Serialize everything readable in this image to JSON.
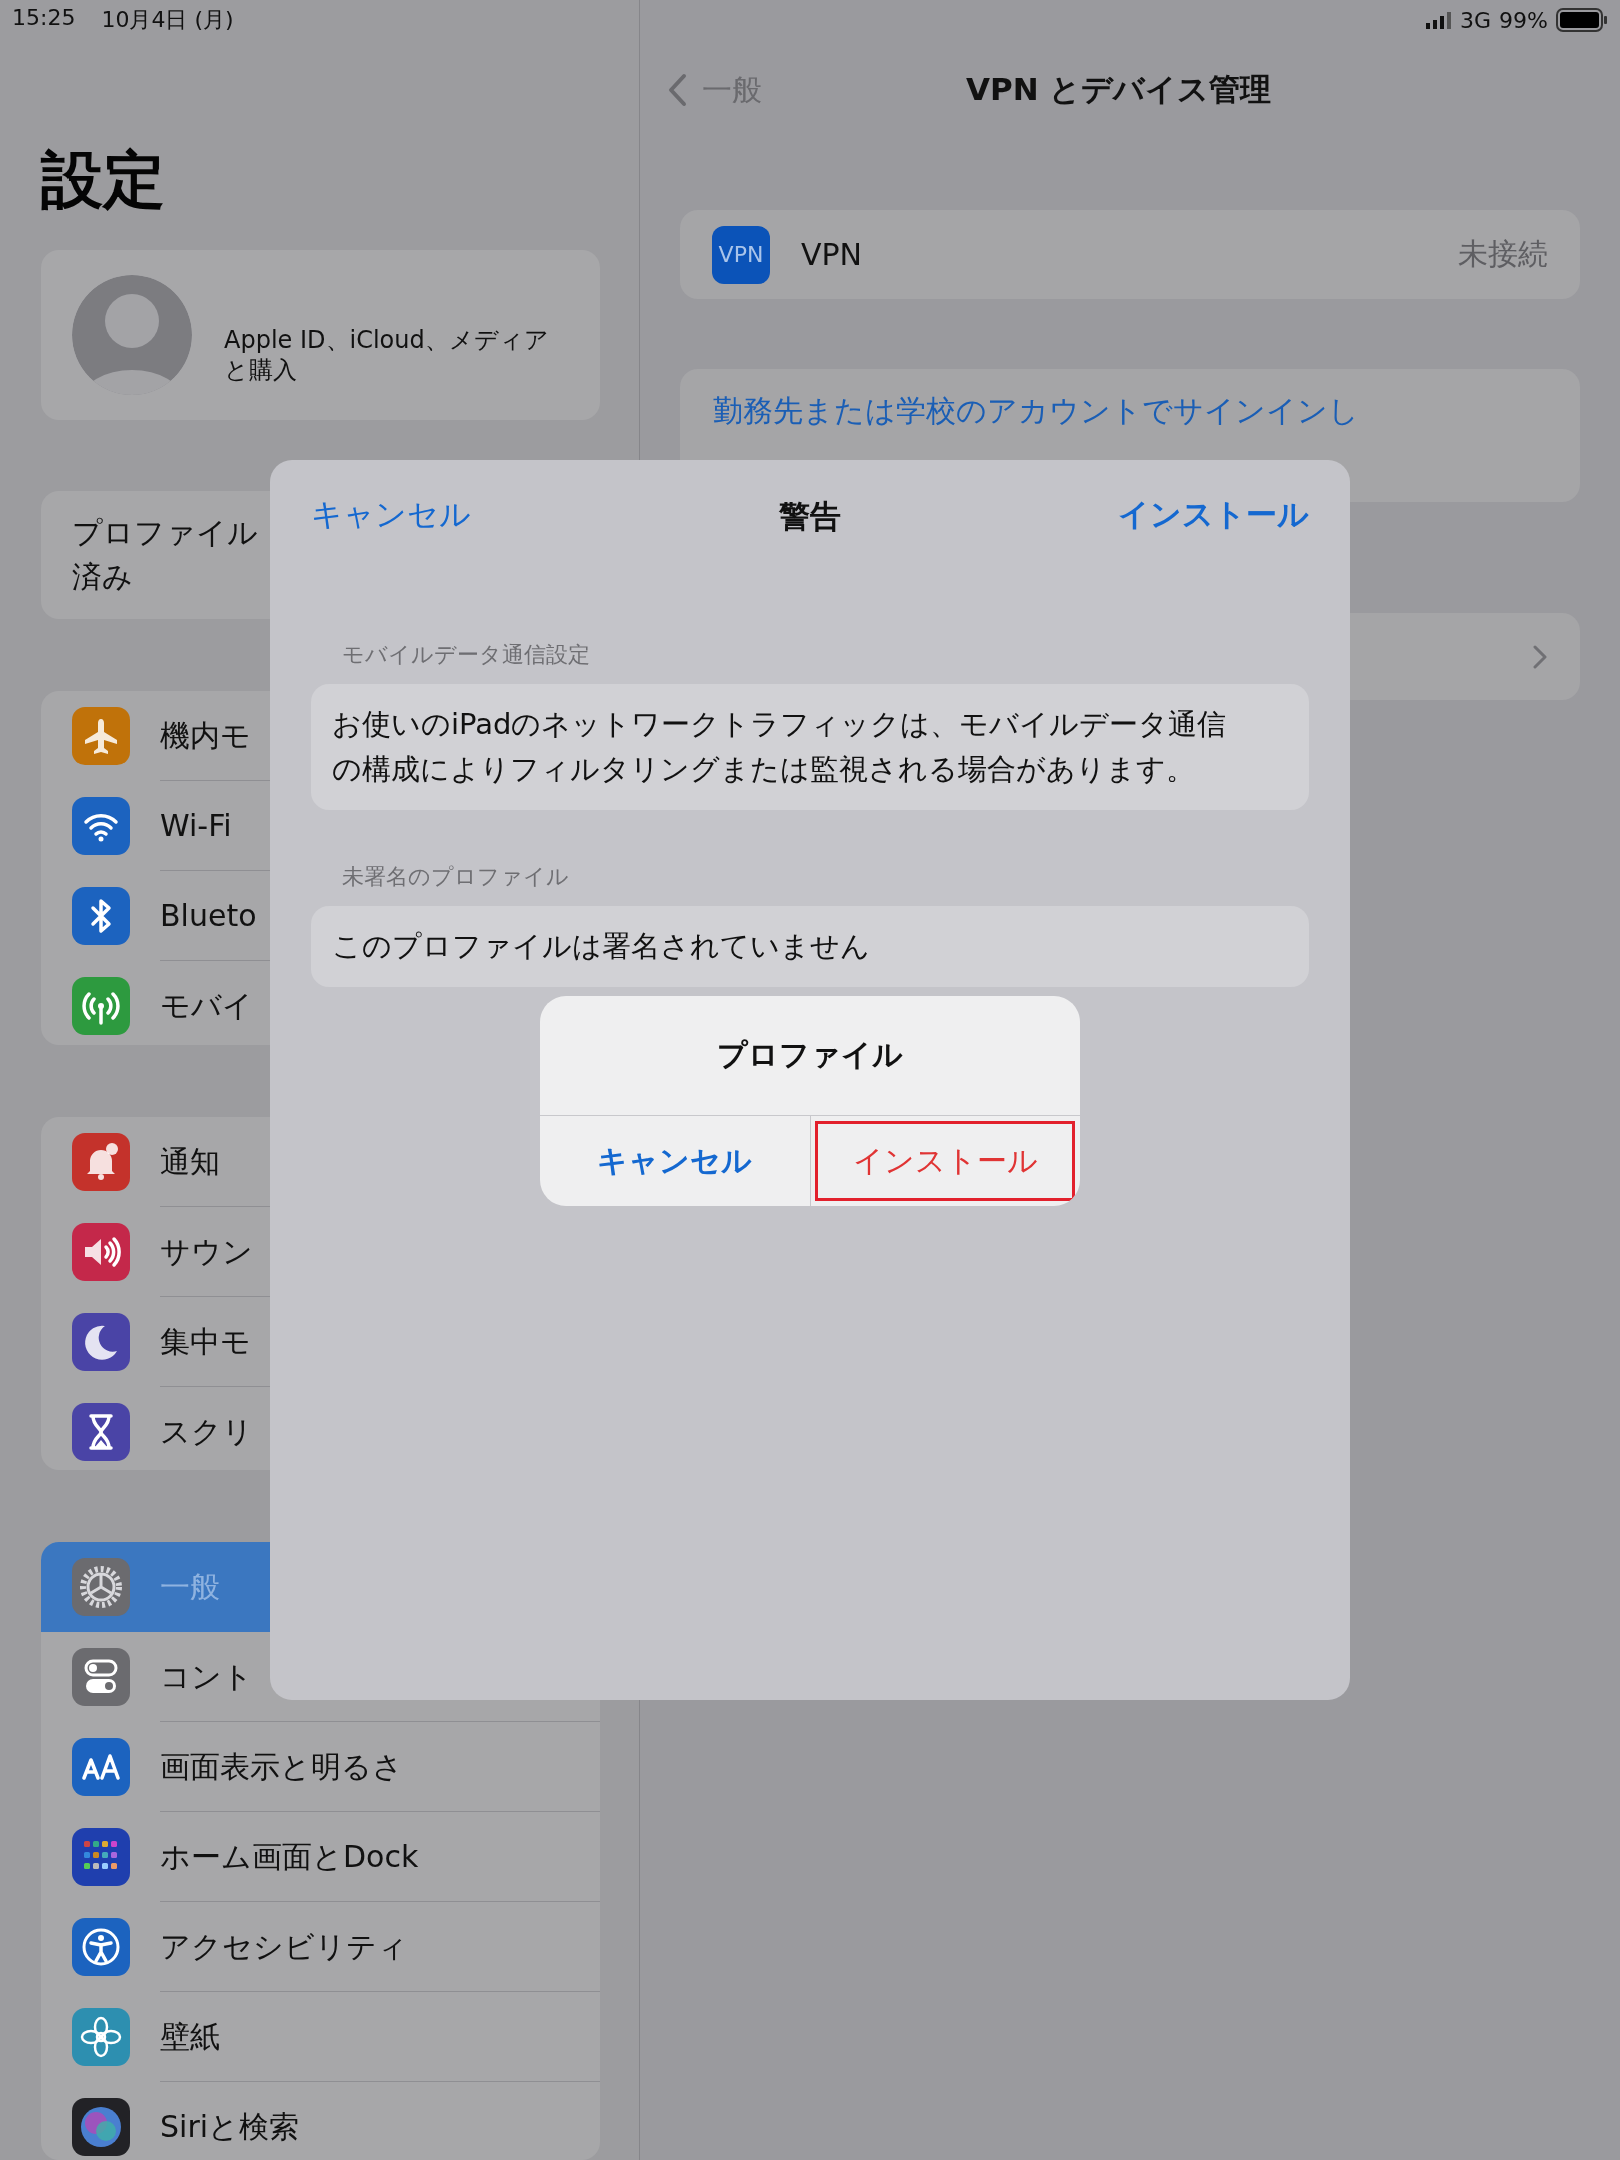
{
  "status_bar": {
    "time": "15:25",
    "date": "10月4日 (月)",
    "network": "3G",
    "battery": "99%"
  },
  "sidebar": {
    "title": "設定",
    "account": {
      "text": "Apple ID、iCloud、メディアと購入"
    },
    "profile_notice": {
      "lines": [
        "プロファイル",
        "済み"
      ]
    },
    "groups": [
      [
        {
          "label": "機内モ",
          "kind": "airplane",
          "color": "#c0720a",
          "selected": false
        },
        {
          "label": "Wi-Fi",
          "kind": "wifi",
          "color": "#1c63bf",
          "selected": false
        },
        {
          "label": "Blueto",
          "kind": "bluetooth",
          "color": "#1c63bf",
          "selected": false
        },
        {
          "label": "モバイ",
          "kind": "antenna",
          "color": "#2d9a3f",
          "selected": false
        }
      ],
      [
        {
          "label": "通知",
          "kind": "bell",
          "color": "#c4322b",
          "selected": false
        },
        {
          "label": "サウン",
          "kind": "speaker",
          "color": "#c4284a",
          "selected": false
        },
        {
          "label": "集中モ",
          "kind": "moon",
          "color": "#4a44a6",
          "selected": false
        },
        {
          "label": "スクリ",
          "kind": "hourglass",
          "color": "#4a44a6",
          "selected": false
        }
      ],
      [
        {
          "label": "一般",
          "kind": "gear",
          "color": "#6b6b6f",
          "selected": true
        },
        {
          "label": "コント",
          "kind": "toggles",
          "color": "#6b6b6f",
          "selected": false
        },
        {
          "label": "画面表示と明るさ",
          "kind": "textsize",
          "color": "#1c63bf",
          "selected": false
        },
        {
          "label": "ホーム画面とDock",
          "kind": "grid",
          "color": "#1f3fae",
          "selected": false
        },
        {
          "label": "アクセシビリティ",
          "kind": "accessibility",
          "color": "#1c63bf",
          "selected": false
        },
        {
          "label": "壁紙",
          "kind": "flower",
          "color": "#2d8fb0",
          "selected": false
        },
        {
          "label": "Siriと検索",
          "kind": "siri",
          "color": "#222226",
          "selected": false
        }
      ]
    ]
  },
  "detail": {
    "nav": {
      "back": "一般",
      "title": "VPN とデバイス管理"
    },
    "vpn_row": {
      "icon_text": "VPN",
      "label": "VPN",
      "status": "未接続"
    },
    "signin_link": "勤務先または学校のアカウントでサインインし"
  },
  "sheet": {
    "cancel": "キャンセル",
    "title": "警告",
    "install": "インストール",
    "sections": [
      {
        "header": "モバイルデータ通信設定",
        "text": "お使いのiPadのネットワークトラフィックは、モバイルデータ通信の構成によりフィルタリングまたは監視される場合があります。"
      },
      {
        "header": "未署名のプロファイル",
        "text": "このプロファイルは署名されていません"
      }
    ]
  },
  "alert": {
    "title": "プロファイル",
    "buttons": [
      {
        "label": "キャンセル",
        "kind": "cancel",
        "highlighted": false
      },
      {
        "label": "インストール",
        "kind": "destructive",
        "highlighted": true
      }
    ]
  }
}
